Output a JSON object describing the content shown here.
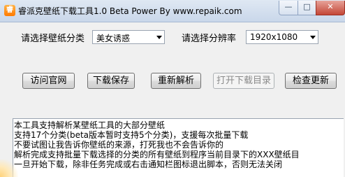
{
  "window": {
    "title": "睿派克壁纸下载工具1.0 Beta Power By www.repaik.com",
    "icon_glyph": "睿",
    "minimize_glyph": "—",
    "maximize_glyph": "□",
    "close_glyph": "✕"
  },
  "form": {
    "category_label": "请选择壁纸分类",
    "category_value": "美女诱惑",
    "resolution_label": "请选择分辨率",
    "resolution_value": "1920x1080"
  },
  "buttons": {
    "visit_site": "访问官网",
    "download_save": "下载保存",
    "reparse": "重新解析",
    "open_download_dir": "打开下载目录",
    "check_update": "检查更新"
  },
  "log": {
    "lines": [
      "本工具支持解析某壁纸工具的大部分壁纸",
      "支持17个分类(beta版本暂时支持5个分类)，支援每次批量下载",
      "不要试图让我告诉你壁纸的来源，打死我也不会告诉你的",
      "解析完成支持批量下载选择的分类的所有壁纸到程序当前目录下的XXX壁纸目",
      "一旦开始下载，除非任务完成或右击通知栏图标退出脚本，否则无法关闭"
    ]
  },
  "colors": {
    "titlebar": "#c9d7ea",
    "close_button": "#c44737",
    "window_bg": "#f0f0f0"
  }
}
